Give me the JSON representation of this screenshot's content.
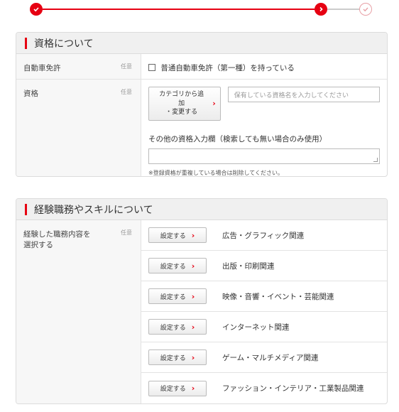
{
  "colors": {
    "accent": "#e60012",
    "section_bg": "#f0f0f0",
    "border": "#dcdcdc"
  },
  "stepper": {
    "icons": [
      "check-icon",
      "chevron-right-icon",
      "check-circle-icon"
    ]
  },
  "qualifications": {
    "title": "資格について",
    "license": {
      "label": "自動車免許",
      "optional": "任意",
      "checkbox_label": "普通自動車免許（第一種）を持っている"
    },
    "quals": {
      "label": "資格",
      "optional": "任意",
      "category_button_line1": "カテゴリから追加",
      "category_button_line2": "・変更する",
      "search_placeholder": "保有している資格名を入力してください",
      "other_label": "その他の資格入力欄（検索しても無い場合のみ使用）",
      "note": "※登録資格が重複している場合は削除してください。"
    }
  },
  "skills": {
    "title": "経験職務やスキルについて",
    "label_line1": "経験した職務内容を",
    "label_line2": "選択する",
    "optional": "任意",
    "button_label": "設定する",
    "jobs": [
      "広告・グラフィック関連",
      "出版・印刷関連",
      "映像・音響・イベント・芸能関連",
      "インターネット関連",
      "ゲーム・マルチメディア関連",
      "ファッション・インテリア・工業製品関連"
    ]
  }
}
